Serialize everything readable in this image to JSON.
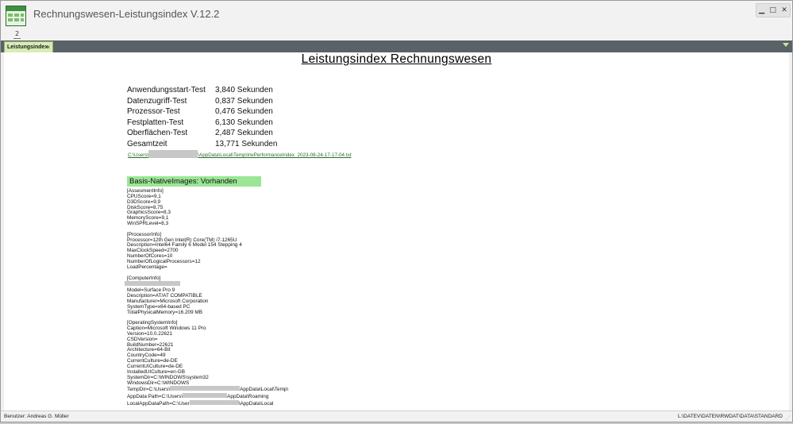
{
  "app": {
    "title": "Rechnungswesen-Leistungsindex V.12.2",
    "window_controls": [
      "▁",
      "□",
      "✕"
    ],
    "toolbar_button": "2"
  },
  "tab": {
    "label": "Leistungsindex",
    "close": "×"
  },
  "report": {
    "title": "Leistungsindex Rechnungswesen",
    "tests": [
      {
        "label": "Anwendungsstart-Test",
        "value": "3,840 Sekunden"
      },
      {
        "label": "Datenzugriff-Test",
        "value": "0,837 Sekunden"
      },
      {
        "label": "Prozessor-Test",
        "value": "0,476 Sekunden"
      },
      {
        "label": "Festplatten-Test",
        "value": "6,130 Sekunden"
      },
      {
        "label": "Oberflächen-Test",
        "value": "2,487 Sekunden"
      },
      {
        "label": "Gesamtzeit",
        "value": "13,771 Sekunden"
      }
    ],
    "log_path_start": "C:\\Users\\",
    "log_path_end": "\\AppData\\Local\\Temp\\IrwPerformanceIndex_2023-08-24-17-17-04.txt",
    "badge": "Basis-NativeImages: Vorhanden",
    "assessment": [
      "[AssesmentInfo]",
      "CPUScore=9,1",
      "D3DScore=9,9",
      "DiskScore=8,75",
      "GraphicsScore=8,3",
      "MemoryScore=9,1",
      "WinSPRLevel=8,3"
    ],
    "processor": [
      "[ProcessorInfo]",
      "Processor=12th Gen Intel(R) Core(TM) i7-1265U",
      "Description=Intel64 Family 6 Model 154 Stepping 4",
      "MaxClockSpeed=2700",
      "NumberOfCores=10",
      "NumberOfLogicalProcessors=12",
      "LoadPercentage="
    ],
    "computer_header": "[ComputerInfo]",
    "computer": [
      "Model=Surface Pro 9",
      "Description=AT/AT COMPATIBLE",
      "Manufacturer=Microsoft Corporation",
      "SystemType=x64-based PC",
      "TotalPhysicalMemory=16.209 MB"
    ],
    "os": [
      "[OperatingSystemInfo]",
      "Caption=Microsoft Windows 11 Pro",
      "Version=10.0.22621",
      "CSDVersion=",
      "BuildNumber=22621",
      "Architecture=64-Bit",
      "CountryCode=49",
      "CurrentCulture=de-DE",
      "CurrentUICulture=de-DE",
      "InstalledUICulture=en-GB",
      "SystemDir=C:\\WINDOWS\\system32",
      "WindowsDir=C:\\WINDOWS"
    ],
    "tempdir": {
      "start": "TempDir=C:\\Users\\",
      "end": "AppData\\Local\\Temp\\"
    },
    "appdata": {
      "start": "AppData Path=C:\\Users\\",
      "end": "AppData\\Roaming"
    },
    "localappdata": {
      "start": "LocalAppDataPath=C:\\User",
      "end": "\\AppData\\Local"
    }
  },
  "status": {
    "user": "Benutzer: Andreas G. Müller",
    "path": "L:\\DATEV\\DATEN\\RWDAT\\DATA\\STANDARD"
  }
}
